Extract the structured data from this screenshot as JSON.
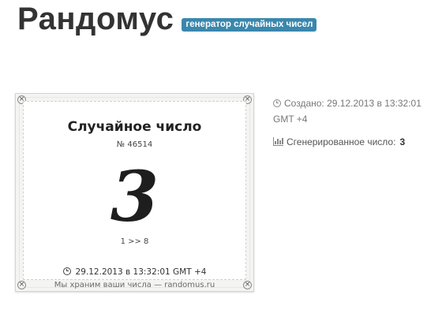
{
  "header": {
    "title": "Рандомус",
    "badge": "генератор случайных чисел"
  },
  "card": {
    "title": "Случайное число",
    "number": "№ 46514",
    "value": "3",
    "range": "1 >> 8",
    "date": "29.12.2013 в 13:32:01 GMT +4",
    "footer": "Мы храним ваши числа — randomus.ru",
    "clock_icon": "clock-icon",
    "corner_icon": "close-icon"
  },
  "info": {
    "created": "Создано: 29.12.2013 в 13:32:01 GMT +4",
    "generated_label": "Сгенерированное число:",
    "generated_value": "3",
    "created_icon": "clock-icon",
    "generated_icon": "bar-chart-icon"
  },
  "colors": {
    "badge": "#3a87ad",
    "title": "#333333"
  }
}
